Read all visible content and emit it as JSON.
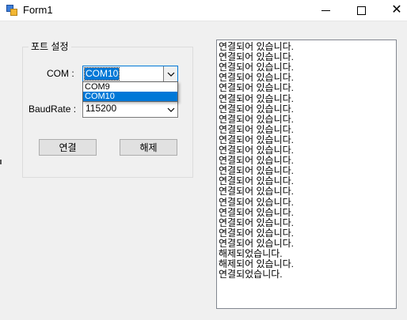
{
  "window": {
    "title": "Form1"
  },
  "group": {
    "label": "포트 설정"
  },
  "com": {
    "label": "COM :",
    "value": "COM10",
    "options": [
      "COM9",
      "COM10"
    ]
  },
  "baud": {
    "label": "BaudRate :",
    "value": "115200"
  },
  "buttons": {
    "connect": "연결",
    "disconnect": "해제"
  },
  "log": {
    "lines": [
      "연결되어 있습니다.",
      "연결되어 있습니다.",
      "연결되어 있습니다.",
      "연결되어 있습니다.",
      "연결되어 있습니다.",
      "연결되어 있습니다.",
      "연결되어 있습니다.",
      "연결되어 있습니다.",
      "연결되어 있습니다.",
      "연결되어 있습니다.",
      "연결되어 있습니다.",
      "연결되어 있습니다.",
      "연결되어 있습니다.",
      "연결되어 있습니다.",
      "연결되어 있습니다.",
      "연결되어 있습니다.",
      "연결되어 있습니다.",
      "연결되어 있습니다.",
      "연결되어 있습니다.",
      "연결되어 있습니다.",
      "해제되었습니다.",
      "해제되어 있습니다.",
      "연결되었습니다."
    ]
  }
}
